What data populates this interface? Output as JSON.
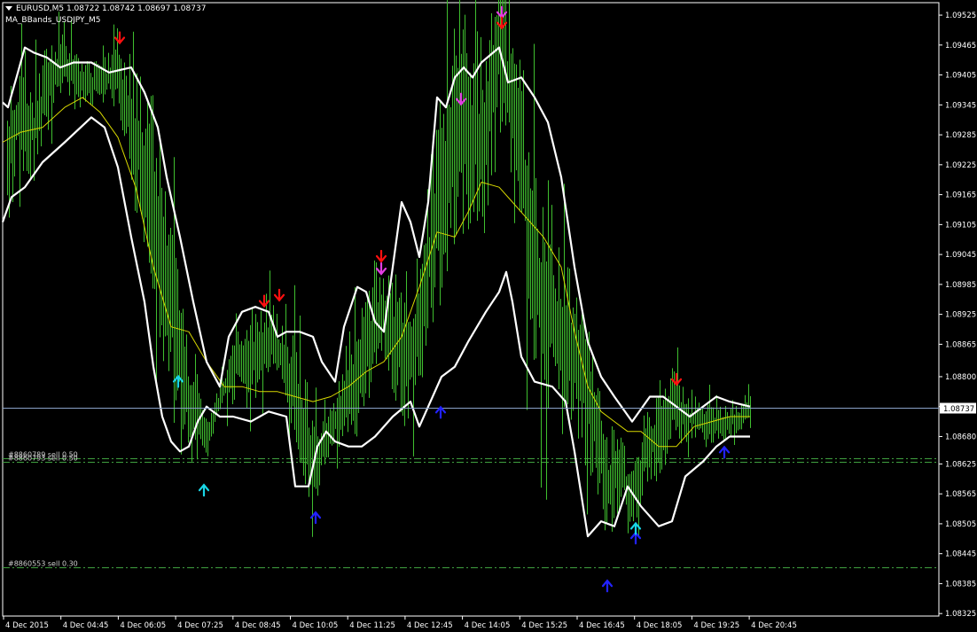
{
  "window": {
    "symbol_line": "EURUSD,M5  1.08722 1.08742 1.08697 1.08737",
    "indicator_name": "MA_BBands_USDJPY_M5"
  },
  "colors": {
    "background": "#000000",
    "candles": "#3fbf2f",
    "ma": "#d8d800",
    "bands": "#ffffff",
    "grid_axis": "#ffffff",
    "bid_line": "#8aa2c8",
    "order_line": "#3f9f3f",
    "arrow_red": "#ff1010",
    "arrow_magenta": "#e23ee2",
    "arrow_cyan": "#19d6e6",
    "arrow_blue": "#2222ff"
  },
  "price_axis": {
    "ticks": [
      "1.09525",
      "1.09465",
      "1.09405",
      "1.09345",
      "1.09285",
      "1.09225",
      "1.09165",
      "1.09105",
      "1.09045",
      "1.08985",
      "1.08925",
      "1.08865",
      "1.08800",
      "1.08740",
      "1.08680",
      "1.08625",
      "1.08565",
      "1.08505",
      "1.08445",
      "1.08385",
      "1.08325"
    ],
    "current_price": "1.08737",
    "y_range": [
      1.0832,
      1.0955
    ]
  },
  "time_axis": {
    "labels": [
      "4 Dec 2015",
      "4 Dec 04:45",
      "4 Dec 06:05",
      "4 Dec 07:25",
      "4 Dec 08:45",
      "4 Dec 10:05",
      "4 Dec 11:25",
      "4 Dec 12:45",
      "4 Dec 14:05",
      "4 Dec 15:25",
      "4 Dec 16:45",
      "4 Dec 18:05",
      "4 Dec 19:25",
      "4 Dec 20:45"
    ]
  },
  "orders": [
    {
      "label": "#8860789 sell 0.50",
      "price": 1.08636
    },
    {
      "label": "#8860793 sell 0.50",
      "price": 1.0863
    },
    {
      "label": "#8860553 sell 0.30",
      "price": 1.08417
    }
  ],
  "chart_data": {
    "type": "candlestick",
    "symbol": "EURUSD",
    "timeframe": "M5",
    "last_bar": {
      "open": 1.08722,
      "high": 1.08742,
      "low": 1.08697,
      "close": 1.08737
    },
    "upper_band": [
      [
        0,
        1.0935
      ],
      [
        6,
        1.0934
      ],
      [
        14,
        1.0939
      ],
      [
        25,
        1.0946
      ],
      [
        35,
        1.0945
      ],
      [
        50,
        1.0944
      ],
      [
        65,
        1.0942
      ],
      [
        80,
        1.0943
      ],
      [
        100,
        1.0943
      ],
      [
        120,
        1.0941
      ],
      [
        145,
        1.0942
      ],
      [
        160,
        1.0937
      ],
      [
        175,
        1.093
      ],
      [
        185,
        1.092
      ],
      [
        200,
        1.0908
      ],
      [
        215,
        1.0895
      ],
      [
        230,
        1.0883
      ],
      [
        245,
        1.0878
      ],
      [
        255,
        1.0888
      ],
      [
        270,
        1.0893
      ],
      [
        285,
        1.0894
      ],
      [
        300,
        1.0893
      ],
      [
        310,
        1.0888
      ],
      [
        320,
        1.0889
      ],
      [
        335,
        1.0889
      ],
      [
        350,
        1.0888
      ],
      [
        360,
        1.0883
      ],
      [
        375,
        1.0879
      ],
      [
        385,
        1.089
      ],
      [
        400,
        1.0898
      ],
      [
        410,
        1.0897
      ],
      [
        420,
        1.0891
      ],
      [
        430,
        1.0889
      ],
      [
        440,
        1.0902
      ],
      [
        450,
        1.0915
      ],
      [
        460,
        1.0911
      ],
      [
        470,
        1.0904
      ],
      [
        480,
        1.0915
      ],
      [
        490,
        1.0936
      ],
      [
        500,
        1.0934
      ],
      [
        510,
        1.094
      ],
      [
        520,
        1.0942
      ],
      [
        530,
        1.094
      ],
      [
        540,
        1.0943
      ],
      [
        560,
        1.0946
      ],
      [
        570,
        1.0939
      ],
      [
        585,
        1.094
      ],
      [
        600,
        1.0936
      ],
      [
        615,
        1.0931
      ],
      [
        630,
        1.092
      ],
      [
        645,
        1.0902
      ],
      [
        660,
        1.0887
      ],
      [
        675,
        1.088
      ],
      [
        690,
        1.0876
      ],
      [
        710,
        1.0871
      ],
      [
        730,
        1.0876
      ],
      [
        745,
        1.0876
      ],
      [
        760,
        1.0874
      ],
      [
        775,
        1.0872
      ],
      [
        790,
        1.0874
      ],
      [
        805,
        1.0876
      ],
      [
        820,
        1.0875
      ],
      [
        843,
        1.0874
      ]
    ],
    "lower_band": [
      [
        0,
        1.0911
      ],
      [
        10,
        1.0916
      ],
      [
        25,
        1.0918
      ],
      [
        45,
        1.0923
      ],
      [
        70,
        1.0927
      ],
      [
        100,
        1.0932
      ],
      [
        115,
        1.093
      ],
      [
        130,
        1.0922
      ],
      [
        145,
        1.0908
      ],
      [
        160,
        1.0895
      ],
      [
        170,
        1.0882
      ],
      [
        180,
        1.0872
      ],
      [
        190,
        1.0867
      ],
      [
        200,
        1.0865
      ],
      [
        210,
        1.0866
      ],
      [
        220,
        1.0871
      ],
      [
        230,
        1.0874
      ],
      [
        245,
        1.0872
      ],
      [
        260,
        1.0872
      ],
      [
        280,
        1.0871
      ],
      [
        300,
        1.0873
      ],
      [
        320,
        1.0872
      ],
      [
        330,
        1.0858
      ],
      [
        345,
        1.0858
      ],
      [
        355,
        1.0866
      ],
      [
        365,
        1.0869
      ],
      [
        375,
        1.0867
      ],
      [
        390,
        1.0866
      ],
      [
        405,
        1.0866
      ],
      [
        420,
        1.0868
      ],
      [
        440,
        1.0872
      ],
      [
        460,
        1.0875
      ],
      [
        470,
        1.087
      ],
      [
        480,
        1.0874
      ],
      [
        495,
        1.088
      ],
      [
        510,
        1.0882
      ],
      [
        525,
        1.0887
      ],
      [
        545,
        1.0893
      ],
      [
        560,
        1.0897
      ],
      [
        568,
        1.0901
      ],
      [
        575,
        1.0895
      ],
      [
        585,
        1.0884
      ],
      [
        600,
        1.0879
      ],
      [
        620,
        1.0878
      ],
      [
        635,
        1.0875
      ],
      [
        645,
        1.0865
      ],
      [
        660,
        1.0848
      ],
      [
        675,
        1.0851
      ],
      [
        690,
        1.085
      ],
      [
        705,
        1.0858
      ],
      [
        720,
        1.0854
      ],
      [
        740,
        1.085
      ],
      [
        755,
        1.0851
      ],
      [
        770,
        1.086
      ],
      [
        790,
        1.0863
      ],
      [
        805,
        1.0866
      ],
      [
        820,
        1.0868
      ],
      [
        843,
        1.0868
      ]
    ],
    "moving_average": [
      [
        0,
        1.0927
      ],
      [
        20,
        1.0929
      ],
      [
        45,
        1.093
      ],
      [
        70,
        1.0934
      ],
      [
        90,
        1.0936
      ],
      [
        110,
        1.0933
      ],
      [
        130,
        1.0928
      ],
      [
        150,
        1.0918
      ],
      [
        170,
        1.0902
      ],
      [
        190,
        1.089
      ],
      [
        210,
        1.0889
      ],
      [
        230,
        1.0883
      ],
      [
        250,
        1.0878
      ],
      [
        270,
        1.0878
      ],
      [
        290,
        1.0877
      ],
      [
        310,
        1.0877
      ],
      [
        330,
        1.0876
      ],
      [
        350,
        1.0875
      ],
      [
        370,
        1.0876
      ],
      [
        390,
        1.0878
      ],
      [
        410,
        1.0881
      ],
      [
        430,
        1.0883
      ],
      [
        450,
        1.0888
      ],
      [
        470,
        1.0898
      ],
      [
        490,
        1.0909
      ],
      [
        510,
        1.0908
      ],
      [
        525,
        1.0913
      ],
      [
        540,
        1.0919
      ],
      [
        560,
        1.0918
      ],
      [
        575,
        1.0915
      ],
      [
        590,
        1.0912
      ],
      [
        610,
        1.0908
      ],
      [
        630,
        1.0902
      ],
      [
        645,
        1.0889
      ],
      [
        660,
        1.0878
      ],
      [
        675,
        1.0873
      ],
      [
        690,
        1.0871
      ],
      [
        705,
        1.0869
      ],
      [
        720,
        1.0869
      ],
      [
        740,
        1.0866
      ],
      [
        760,
        1.0866
      ],
      [
        780,
        1.087
      ],
      [
        800,
        1.0871
      ],
      [
        820,
        1.0872
      ],
      [
        843,
        1.0872
      ]
    ],
    "signals": [
      {
        "x": 132,
        "price": 1.09478,
        "dir": "down",
        "color": "arrow_red"
      },
      {
        "x": 198,
        "price": 1.08792,
        "dir": "up",
        "color": "arrow_cyan"
      },
      {
        "x": 227,
        "price": 1.08574,
        "dir": "up",
        "color": "arrow_cyan"
      },
      {
        "x": 295,
        "price": 1.0895,
        "dir": "down",
        "color": "arrow_red"
      },
      {
        "x": 312,
        "price": 1.08962,
        "dir": "down",
        "color": "arrow_red"
      },
      {
        "x": 353,
        "price": 1.08519,
        "dir": "up",
        "color": "arrow_blue"
      },
      {
        "x": 427,
        "price": 1.0904,
        "dir": "down",
        "color": "arrow_red"
      },
      {
        "x": 427,
        "price": 1.09015,
        "dir": "down",
        "color": "arrow_magenta"
      },
      {
        "x": 494,
        "price": 1.0873,
        "dir": "up",
        "color": "arrow_blue"
      },
      {
        "x": 517,
        "price": 1.09355,
        "dir": "down",
        "color": "arrow_magenta"
      },
      {
        "x": 563,
        "price": 1.09529,
        "dir": "down",
        "color": "arrow_magenta"
      },
      {
        "x": 563,
        "price": 1.09508,
        "dir": "down",
        "color": "arrow_red"
      },
      {
        "x": 682,
        "price": 1.08382,
        "dir": "up",
        "color": "arrow_blue"
      },
      {
        "x": 714,
        "price": 1.08478,
        "dir": "up",
        "color": "arrow_blue"
      },
      {
        "x": 714,
        "price": 1.08497,
        "dir": "up",
        "color": "arrow_cyan"
      },
      {
        "x": 760,
        "price": 1.08793,
        "dir": "down",
        "color": "arrow_red"
      },
      {
        "x": 814,
        "price": 1.0865,
        "dir": "up",
        "color": "arrow_blue"
      }
    ],
    "price_path": [
      [
        5,
        1.0924
      ],
      [
        20,
        1.0933
      ],
      [
        35,
        1.0929
      ],
      [
        50,
        1.0938
      ],
      [
        70,
        1.0943
      ],
      [
        90,
        1.0939
      ],
      [
        110,
        1.0939
      ],
      [
        130,
        1.0941
      ],
      [
        150,
        1.0927
      ],
      [
        170,
        1.0916
      ],
      [
        185,
        1.0898
      ],
      [
        200,
        1.0883
      ],
      [
        215,
        1.0872
      ],
      [
        230,
        1.0868
      ],
      [
        245,
        1.0876
      ],
      [
        260,
        1.0882
      ],
      [
        275,
        1.0884
      ],
      [
        290,
        1.0885
      ],
      [
        305,
        1.0888
      ],
      [
        320,
        1.0882
      ],
      [
        335,
        1.0873
      ],
      [
        350,
        1.0862
      ],
      [
        365,
        1.0868
      ],
      [
        380,
        1.0872
      ],
      [
        395,
        1.0878
      ],
      [
        410,
        1.0885
      ],
      [
        425,
        1.0893
      ],
      [
        440,
        1.0889
      ],
      [
        455,
        1.0883
      ],
      [
        470,
        1.0891
      ],
      [
        485,
        1.0909
      ],
      [
        500,
        1.0922
      ],
      [
        515,
        1.0932
      ],
      [
        530,
        1.0927
      ],
      [
        545,
        1.093
      ],
      [
        560,
        1.0947
      ],
      [
        575,
        1.0932
      ],
      [
        590,
        1.0915
      ],
      [
        605,
        1.0898
      ],
      [
        620,
        1.0892
      ],
      [
        635,
        1.0888
      ],
      [
        650,
        1.0882
      ],
      [
        665,
        1.0873
      ],
      [
        680,
        1.0858
      ],
      [
        695,
        1.0862
      ],
      [
        710,
        1.0855
      ],
      [
        725,
        1.0865
      ],
      [
        740,
        1.0869
      ],
      [
        755,
        1.0874
      ],
      [
        770,
        1.0872
      ],
      [
        785,
        1.0871
      ],
      [
        800,
        1.0871
      ],
      [
        815,
        1.087
      ],
      [
        830,
        1.0872
      ],
      [
        843,
        1.08737
      ]
    ]
  }
}
